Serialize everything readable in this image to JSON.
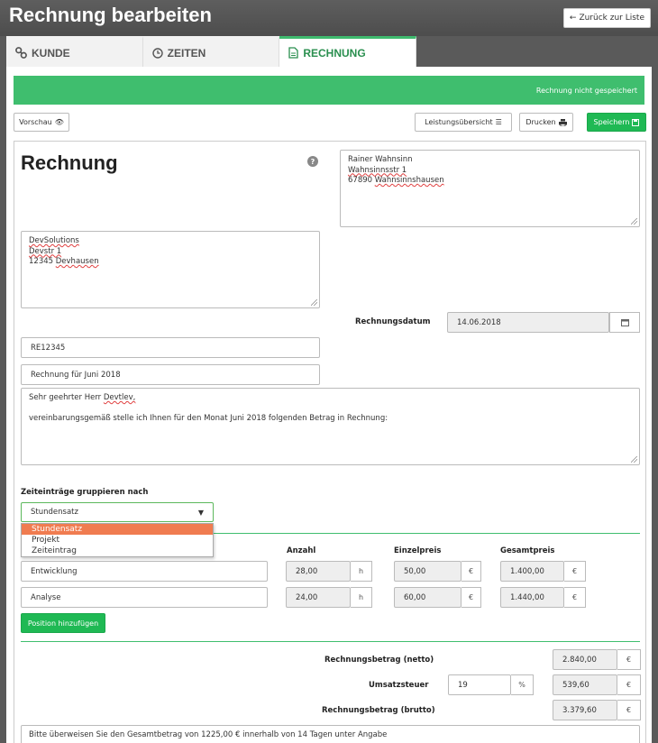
{
  "header": {
    "title": "Rechnung bearbeiten",
    "back_label": "Zurück zur Liste"
  },
  "tabs": [
    {
      "label": "KUNDE",
      "icon": "link-icon"
    },
    {
      "label": "ZEITEN",
      "icon": "clock-icon"
    },
    {
      "label": "RECHNUNG",
      "icon": "document-icon",
      "active": true
    }
  ],
  "status": {
    "text": "Rechnung nicht gespeichert"
  },
  "toolbar": {
    "preview": "Vorschau",
    "overview": "Leistungsübersicht",
    "print": "Drucken",
    "save": "Speichern"
  },
  "invoice": {
    "heading": "Rechnung",
    "help": "?",
    "recipient": {
      "name": "Rainer Wahnsinn",
      "street": "Wahnsinnsstr 1",
      "zip": "67890",
      "city": "Wahnsinnshausen"
    },
    "sender": {
      "name": "DevSolutions",
      "street": "Devstr 1",
      "zip": "12345",
      "city": "Devhausen"
    },
    "date_label": "Rechnungsdatum",
    "date_value": "14.06.2018",
    "number": "RE12345",
    "subject": "Rechnung für Juni 2018",
    "greeting": "Sehr geehrter Herr",
    "greeting_name": "Devtlev,",
    "body": "vereinbarungsgemäß stelle ich Ihnen für den Monat Juni 2018 folgenden Betrag in Rechnung:",
    "group_label": "Zeiteinträge gruppieren nach",
    "group_value": "Stundensatz",
    "group_options": [
      "Stundensatz",
      "Projekt",
      "Zeiteintrag"
    ]
  },
  "positions": {
    "columns": {
      "quantity": "Anzahl",
      "unit_price": "Einzelpreis",
      "total": "Gesamtpreis"
    },
    "rows": [
      {
        "name": "Entwicklung",
        "quantity": "28,00",
        "unit": "h",
        "unit_price": "50,00",
        "currency": "€",
        "total": "1.400,00"
      },
      {
        "name": "Analyse",
        "quantity": "24,00",
        "unit": "h",
        "unit_price": "60,00",
        "currency": "€",
        "total": "1.440,00"
      }
    ],
    "add_label": "Position hinzufügen"
  },
  "totals": {
    "net_label": "Rechnungsbetrag (netto)",
    "net_value": "2.840,00",
    "tax_label": "Umsatzsteuer",
    "tax_rate": "19",
    "tax_unit": "%",
    "tax_value": "539,60",
    "gross_label": "Rechnungsbetrag (brutto)",
    "gross_value": "3.379,60",
    "currency": "€"
  },
  "footer_text": "Bitte überweisen Sie den Gesamtbetrag von 1225,00 € innerhalb von 14 Tagen unter Angabe",
  "colors": {
    "accent": "#3fbe6e",
    "save": "#1fb954",
    "highlight": "#f07c50"
  }
}
